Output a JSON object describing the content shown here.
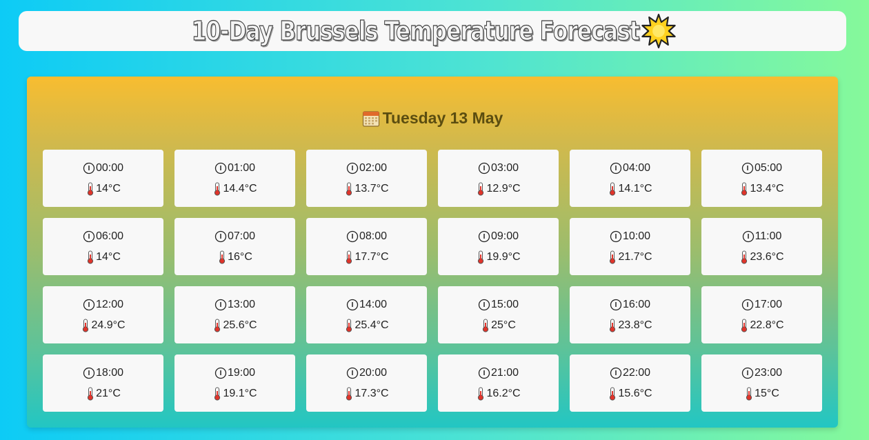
{
  "header": {
    "title": "10-Day Brussels Temperature Forecast",
    "icon": "sun-icon"
  },
  "day": {
    "label": "Tuesday 13 May",
    "icon": "calendar-icon"
  },
  "hours": [
    {
      "time": "00:00",
      "temp": "14°C"
    },
    {
      "time": "01:00",
      "temp": "14.4°C"
    },
    {
      "time": "02:00",
      "temp": "13.7°C"
    },
    {
      "time": "03:00",
      "temp": "12.9°C"
    },
    {
      "time": "04:00",
      "temp": "14.1°C"
    },
    {
      "time": "05:00",
      "temp": "13.4°C"
    },
    {
      "time": "06:00",
      "temp": "14°C"
    },
    {
      "time": "07:00",
      "temp": "16°C"
    },
    {
      "time": "08:00",
      "temp": "17.7°C"
    },
    {
      "time": "09:00",
      "temp": "19.9°C"
    },
    {
      "time": "10:00",
      "temp": "21.7°C"
    },
    {
      "time": "11:00",
      "temp": "23.6°C"
    },
    {
      "time": "12:00",
      "temp": "24.9°C"
    },
    {
      "time": "13:00",
      "temp": "25.6°C"
    },
    {
      "time": "14:00",
      "temp": "25.4°C"
    },
    {
      "time": "15:00",
      "temp": "25°C"
    },
    {
      "time": "16:00",
      "temp": "23.8°C"
    },
    {
      "time": "17:00",
      "temp": "22.8°C"
    },
    {
      "time": "18:00",
      "temp": "21°C"
    },
    {
      "time": "19:00",
      "temp": "19.1°C"
    },
    {
      "time": "20:00",
      "temp": "17.3°C"
    },
    {
      "time": "21:00",
      "temp": "16.2°C"
    },
    {
      "time": "22:00",
      "temp": "15.6°C"
    },
    {
      "time": "23:00",
      "temp": "15°C"
    }
  ],
  "colors": {
    "panel_top": "#f8bd30",
    "panel_bottom": "#22c6c3",
    "day_heading": "#5b4d10",
    "thermometer": "#e0342b"
  }
}
